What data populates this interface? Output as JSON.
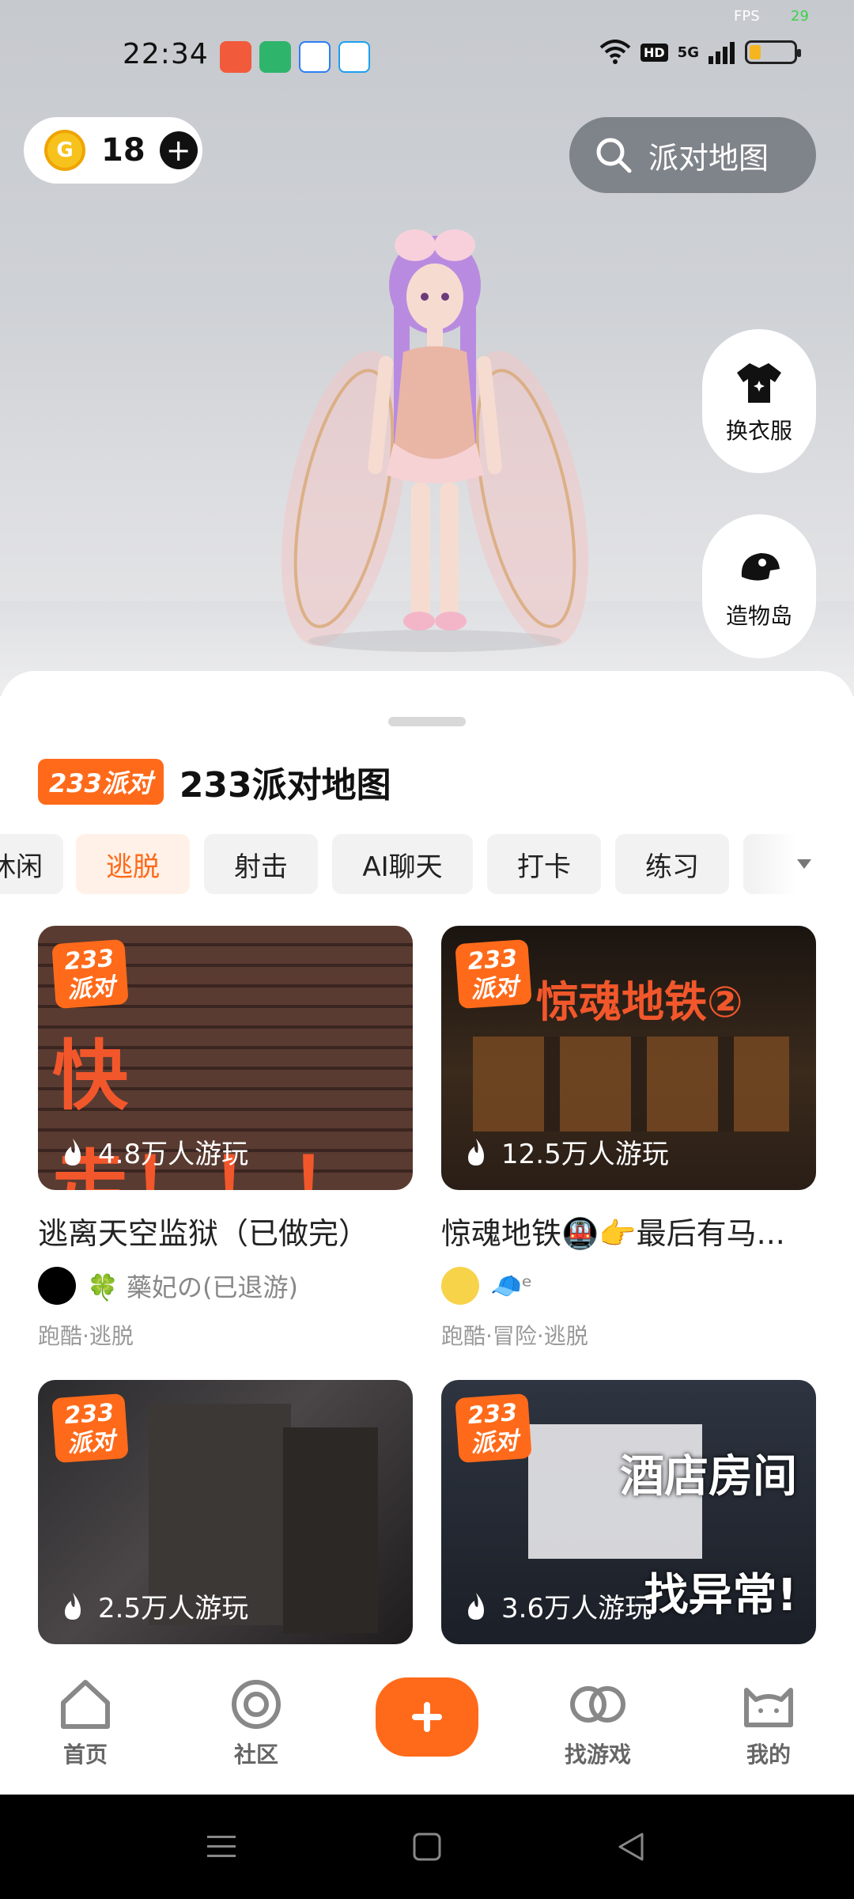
{
  "status_bar": {
    "time": "22:34",
    "fps_label": "FPS",
    "fps_value": "29",
    "hd": "HD",
    "network": "5G"
  },
  "coins": {
    "count": "18"
  },
  "search": {
    "placeholder": "派对地图"
  },
  "side_buttons": [
    {
      "label": "换衣服",
      "icon": "tshirt-icon"
    },
    {
      "label": "造物岛",
      "icon": "hat-icon"
    }
  ],
  "section": {
    "badge": "233派对",
    "title": "233派对地图"
  },
  "tabs": [
    "休闲",
    "逃脱",
    "射击",
    "AI聊天",
    "打卡",
    "练习",
    ""
  ],
  "active_tab": "逃脱",
  "cards": [
    {
      "cover_text": "快走！！！",
      "plays": "4.8万人游玩",
      "title": "逃离天空监狱（已做完）",
      "author": "🍀 藥妃の(已退游)",
      "tags": "跑酷·逃脱"
    },
    {
      "cover_text": "惊魂地铁②",
      "plays": "12.5万人游玩",
      "title": "惊魂地铁🚇👉最后有马...",
      "author": "🧢ᵉ",
      "tags": "跑酷·冒险·逃脱"
    },
    {
      "cover_text": "",
      "plays": "2.5万人游玩"
    },
    {
      "cover_text": "酒店房间 找异常!",
      "plays": "3.6万人游玩"
    }
  ],
  "logo_text": "233派对",
  "bottom_nav": [
    {
      "label": "首页"
    },
    {
      "label": "社区"
    },
    {
      "label": "找游戏"
    },
    {
      "label": "我的"
    }
  ],
  "colors": {
    "accent": "#ff6a1a",
    "active_tab_bg": "#fff1e7"
  }
}
